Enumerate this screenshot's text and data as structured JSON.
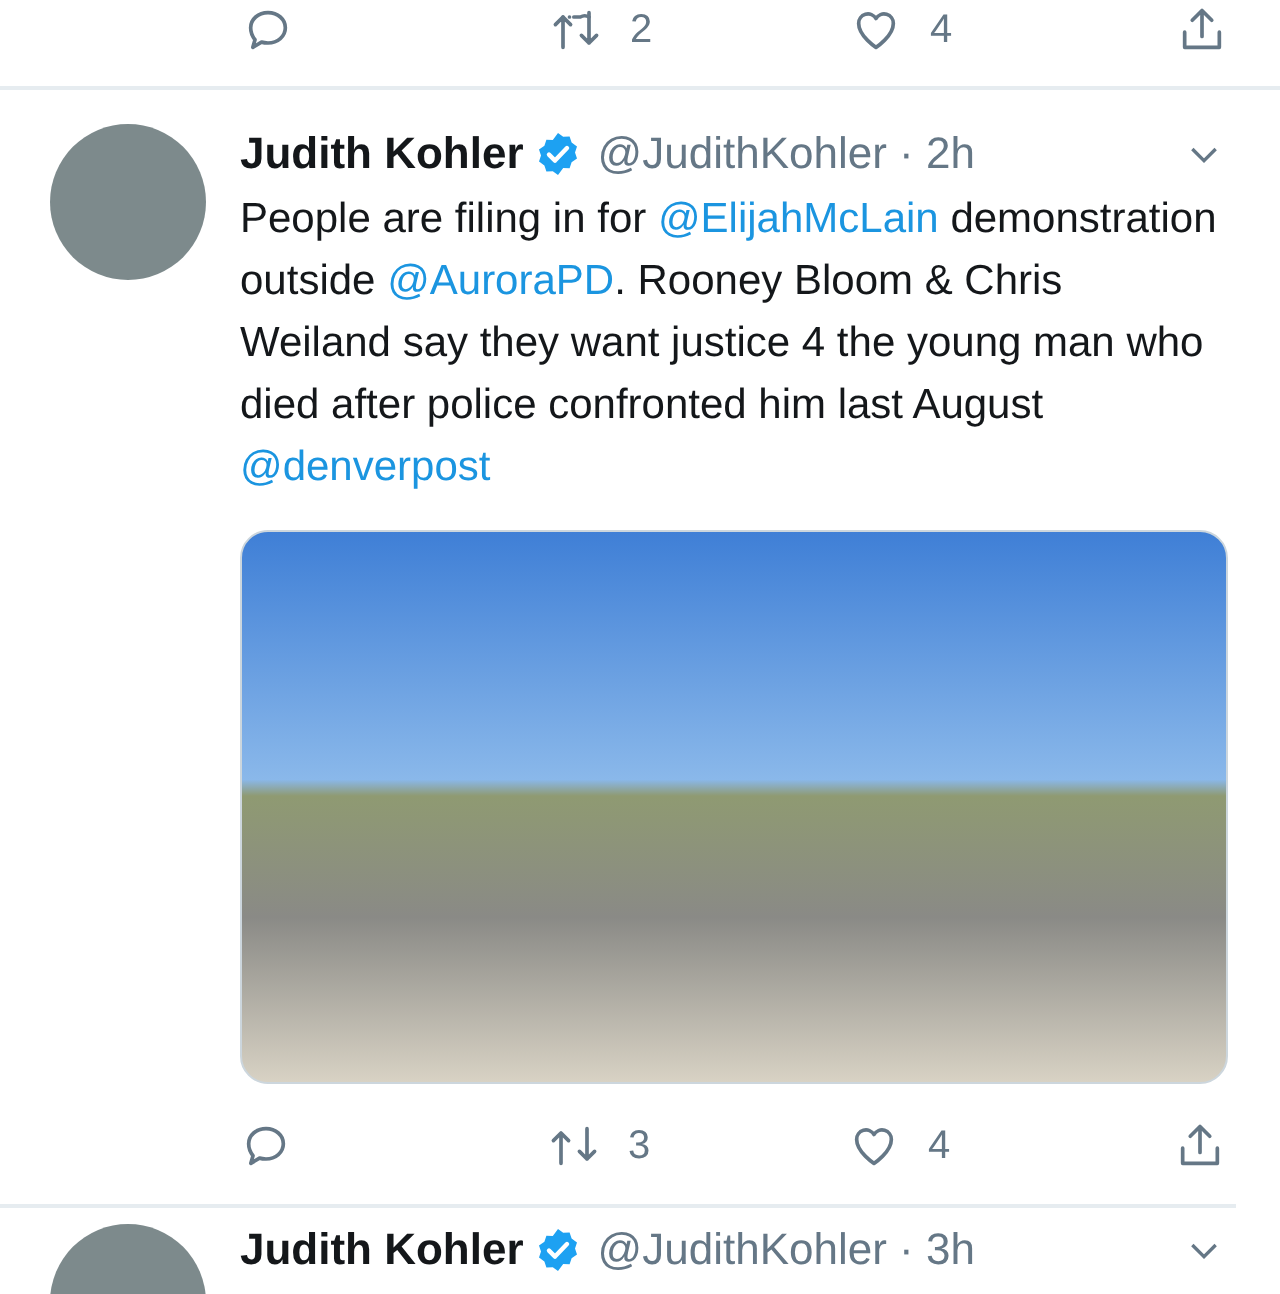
{
  "top_actions": [
    {
      "kind": "reply"
    },
    {
      "kind": "retweet",
      "count": "2"
    },
    {
      "kind": "like",
      "count": "4"
    },
    {
      "kind": "share"
    }
  ],
  "tweets": [
    {
      "author": {
        "name": "Judith Kohler",
        "verified": true,
        "meta": "@JudithKohler · 2h"
      },
      "body": [
        {
          "kind": "text",
          "text": "People are filing in for "
        },
        {
          "kind": "link",
          "text": "@ElijahMcLain"
        },
        {
          "kind": "text",
          "text": " demonstration outside "
        },
        {
          "kind": "link",
          "text": "@AuroraPD"
        },
        {
          "kind": "text",
          "text": ". Rooney Bloom & Chris Weiland say they want justice 4 the young man who died after police confronted him last August "
        },
        {
          "kind": "link",
          "text": "@denverpost"
        }
      ],
      "media": {
        "kind": "photo"
      },
      "actions": [
        {
          "kind": "reply"
        },
        {
          "kind": "retweet",
          "count": "3"
        },
        {
          "kind": "like",
          "count": "4"
        },
        {
          "kind": "share"
        }
      ]
    },
    {
      "author": {
        "name": "Judith Kohler",
        "verified": true,
        "meta": "@JudithKohler · 3h"
      }
    }
  ]
}
